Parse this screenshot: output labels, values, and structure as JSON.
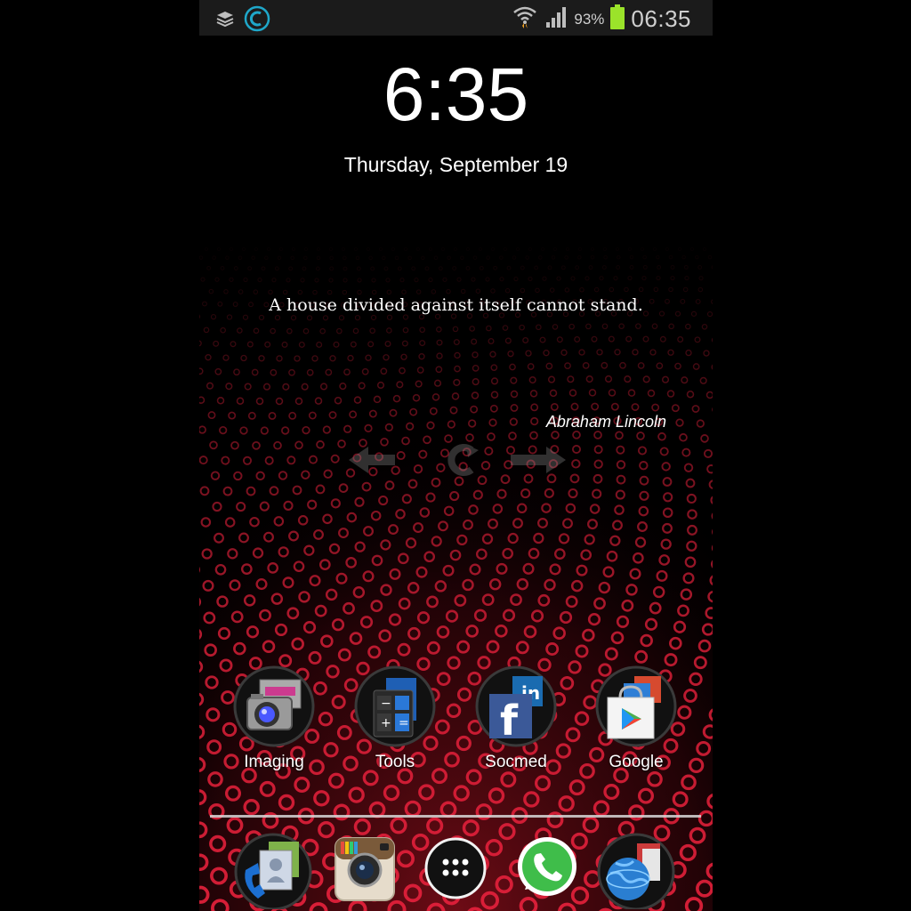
{
  "status_bar": {
    "battery_percent": "93%",
    "time": "06:35",
    "left_icons": [
      "layers-icon",
      "c-app-icon"
    ],
    "right_icons": [
      "wifi-icon",
      "signal-icon",
      "battery-icon"
    ],
    "battery_level": 0.93
  },
  "lockscreen": {
    "clock": "6:35",
    "date": "Thursday, September 19"
  },
  "quote_widget": {
    "text": "A house divided against itself cannot stand.",
    "author": "Abraham Lincoln",
    "controls": [
      "previous-arrow-icon",
      "refresh-icon",
      "next-arrow-icon"
    ]
  },
  "app_folders": [
    {
      "label": "Imaging",
      "icon": "camera-icon"
    },
    {
      "label": "Tools",
      "icon": "calculator-icon"
    },
    {
      "label": "Socmed",
      "icon": "facebook-icon"
    },
    {
      "label": "Google",
      "icon": "play-store-icon"
    }
  ],
  "dock": [
    {
      "icon": "phone-contacts-icon"
    },
    {
      "icon": "instagram-icon"
    },
    {
      "icon": "app-drawer-icon"
    },
    {
      "icon": "whatsapp-icon"
    },
    {
      "icon": "browser-globe-icon"
    }
  ],
  "colors": {
    "background": "#000000",
    "wallpaper_dots": "#e0203a",
    "battery": "#9be32a",
    "status_bar": "#1b1b1b"
  }
}
